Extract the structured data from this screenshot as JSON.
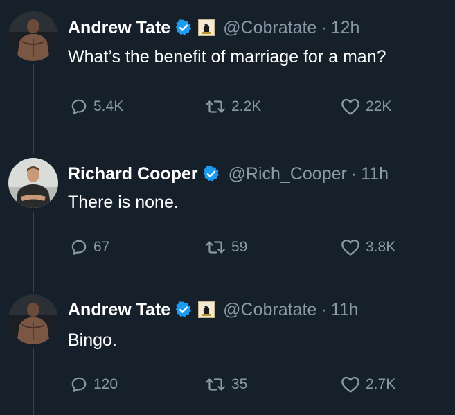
{
  "tweets": [
    {
      "name": "Andrew Tate",
      "handle": "@Cobratate",
      "separator": "·",
      "time": "12h",
      "text": "What’s the benefit of marriage for a man?",
      "replies": "5.4K",
      "retweets": "2.2K",
      "likes": "22K",
      "verified": true,
      "affiliate_badge": "chess-knight-icon"
    },
    {
      "name": "Richard Cooper",
      "handle": "@Rich_Cooper",
      "separator": "·",
      "time": "11h",
      "text": "There is none.",
      "replies": "67",
      "retweets": "59",
      "likes": "3.8K",
      "verified": true
    },
    {
      "name": "Andrew Tate",
      "handle": "@Cobratate",
      "separator": "·",
      "time": "11h",
      "text": "Bingo.",
      "replies": "120",
      "retweets": "35",
      "likes": "2.7K",
      "verified": true,
      "affiliate_badge": "chess-knight-icon"
    }
  ],
  "colors": {
    "background": "#15202b",
    "text": "#ffffff",
    "secondary": "#8b98a5",
    "verified": "#1d9bf0",
    "thread_line": "#38444d"
  }
}
